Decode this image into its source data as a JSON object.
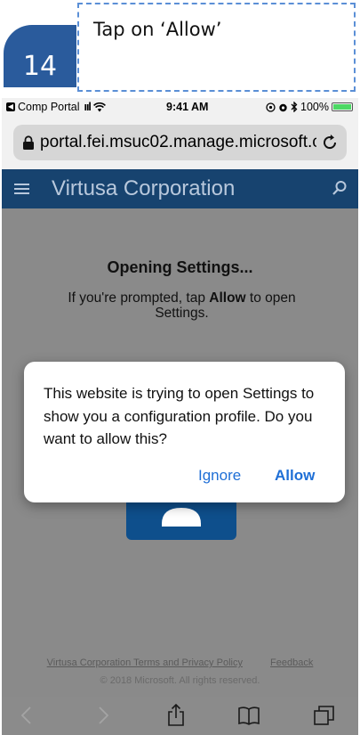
{
  "step": {
    "number": "14",
    "instruction": "Tap on ‘Allow’"
  },
  "status_bar": {
    "back_app": "Comp Portal",
    "signal": "ııl",
    "time": "9:41 AM",
    "battery": "100%"
  },
  "browser": {
    "url": "portal.fei.msuc02.manage.microsoft.c"
  },
  "portal": {
    "title": "Virtusa Corporation",
    "heading": "Opening Settings...",
    "prompt_prefix": "If you're prompted, tap ",
    "prompt_bold": "Allow",
    "prompt_suffix": " to open Settings.",
    "footer_terms": "Virtusa Corporation Terms and Privacy Policy",
    "footer_feedback": "Feedback",
    "copyright": "© 2018 Microsoft. All rights reserved."
  },
  "dialog": {
    "message": "This website is trying to open Settings to show you a configuration profile. Do you want to allow this?",
    "ignore_label": "Ignore",
    "allow_label": "Allow"
  },
  "colors": {
    "step_blue": "#2a5b9c",
    "header_blue": "#17436f",
    "link_blue": "#1f6fd6",
    "overlay_gray": "#8a8a8a"
  }
}
